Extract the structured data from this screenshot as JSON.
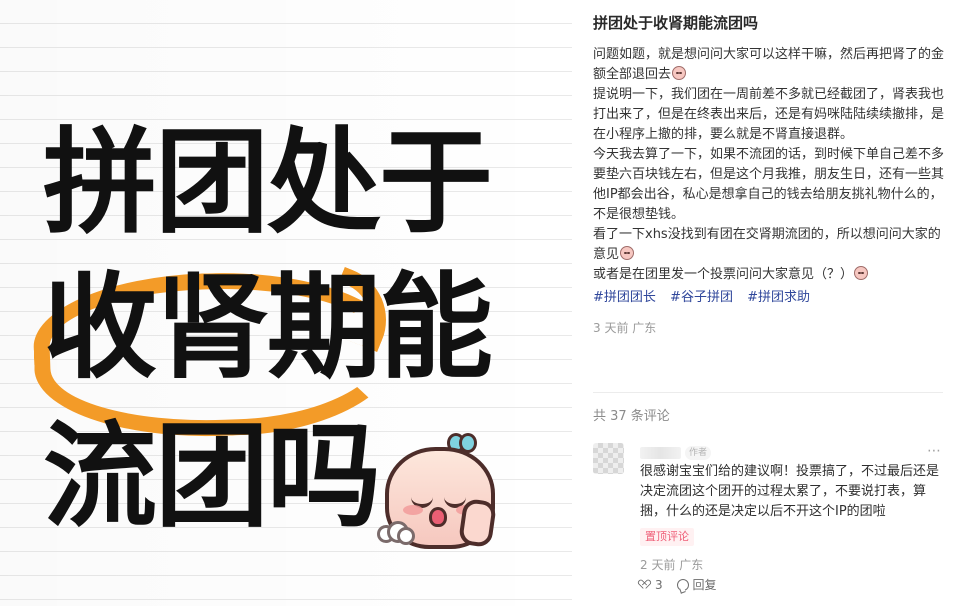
{
  "cover": {
    "line1": "拼团处于",
    "line2": "收肾期能",
    "line3": "流团吗"
  },
  "post": {
    "title": "拼团处于收肾期能流团吗",
    "paragraphs": [
      "问题如题，就是想问问大家可以这样干嘛，然后再把肾了的金额全部退回去",
      "提说明一下，我们团在一周前差不多就已经截团了，肾表我也打出来了，但是在终表出来后，还是有妈咪陆陆续续撤排，是在小程序上撤的排，要么就是不肾直接退群。",
      "今天我去算了一下，如果不流团的话，到时候下单自己差不多要垫六百块钱左右，但是这个月我推，朋友生日，还有一些其他IP都会出谷，私心是想拿自己的钱去给朋友挑礼物什么的，不是很想垫钱。",
      "看了一下xhs没找到有团在交肾期流团的，所以想问问大家的意见",
      "或者是在团里发一个投票问问大家意见（？）"
    ],
    "tags": [
      "#拼团团长",
      "#谷子拼团",
      "#拼团求助"
    ],
    "meta": "3 天前 广东"
  },
  "comments": {
    "count_text": "共 37 条评论",
    "first": {
      "author_badge": "作者",
      "text": "很感谢宝宝们给的建议啊！投票搞了，不过最后还是决定流团这个团开的过程太累了，不要说打表，算捆，什么的还是决定以后不开这个IP的团啦",
      "pin_label": "置顶评论",
      "meta": "2 天前 广东",
      "like_count": "3",
      "reply_label": "回复"
    }
  },
  "colors": {
    "tag": "#30479b",
    "pin_badge": "#ef5f78",
    "circle": "#f39b28"
  },
  "icons": {
    "more": "more-icon",
    "like": "heart-icon",
    "reply": "reply-icon",
    "emoji": "emoji-icon"
  }
}
